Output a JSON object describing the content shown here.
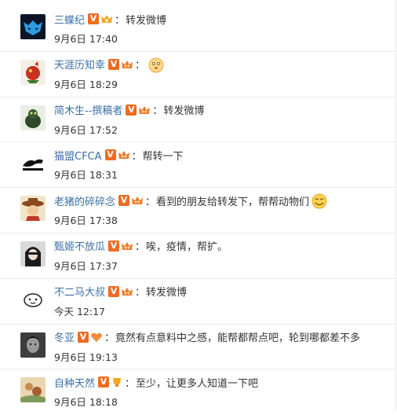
{
  "colors": {
    "username": "#3a6ea5",
    "text": "#333333",
    "v_badge": "#ec6c21",
    "divider": "#ececec"
  },
  "comments": [
    {
      "user": "三蝶纪",
      "crown": "gold",
      "colon": "：",
      "text": "转发微博",
      "emoji": "",
      "time": "9月6日 17:40",
      "avatar": "blue-mask-avatar"
    },
    {
      "user": "天涯历知幸",
      "crown": "pink",
      "colon": "：",
      "text": "",
      "emoji": "face-emoji",
      "time": "9月6日 18:29",
      "avatar": "red-dragon-avatar"
    },
    {
      "user": "简木生--撰稿者",
      "crown": "pink",
      "colon": "：",
      "text": "转发微博",
      "emoji": "",
      "time": "9月6日 17:52",
      "avatar": "green-creature-avatar"
    },
    {
      "user": "猫盟CFCA",
      "crown": "pink",
      "colon": "：",
      "text": "帮转一下",
      "emoji": "",
      "time": "9月6日 18:31",
      "avatar": "leopard-logo-avatar"
    },
    {
      "user": "老猪的碎碎念",
      "crown": "pink",
      "colon": "：",
      "text": "看到的朋友给转发下，帮帮动物们",
      "emoji": "smile-emoji",
      "time": "9月6日 17:38",
      "avatar": "hat-character-avatar"
    },
    {
      "user": "甄姬不放瓜",
      "crown": "pink",
      "colon": "：",
      "text": "唉，疫情，帮扩。",
      "emoji": "",
      "time": "9月6日 17:37",
      "avatar": "dark-hair-avatar"
    },
    {
      "user": "不二马大叔",
      "crown": "pink",
      "colon": "：",
      "text": "转发微博",
      "emoji": "",
      "time": "今天 12:17",
      "avatar": "sketch-sheep-avatar"
    },
    {
      "user": "冬亚",
      "crown": "heart",
      "colon": "：",
      "text": "竟然有点意料中之感，能帮都帮点吧，轮到哪都差不多",
      "emoji": "",
      "time": "9月6日 19:13",
      "avatar": "gray-portrait-avatar"
    },
    {
      "user": "自种天然",
      "crown": "cup",
      "colon": "：",
      "text": "至少，让更多人知道一下吧",
      "emoji": "",
      "time": "9月6日 18:18",
      "avatar": "painting-avatar"
    }
  ]
}
